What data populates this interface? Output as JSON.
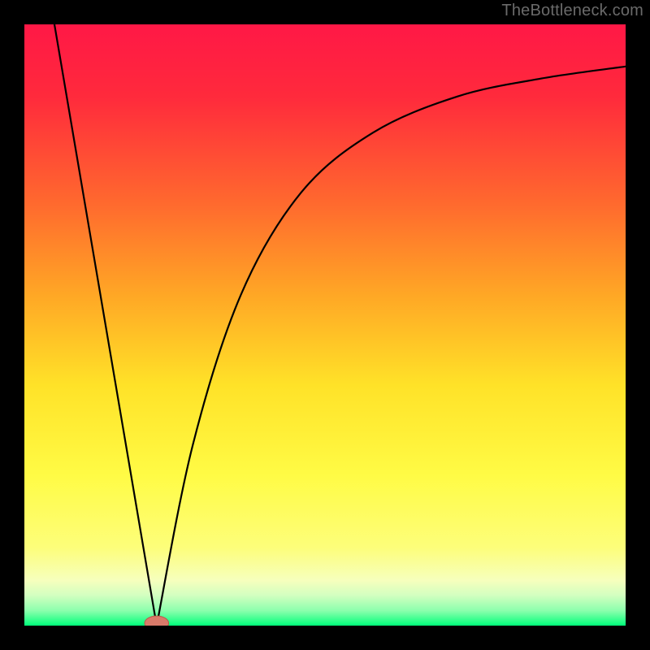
{
  "watermark": "TheBottleneck.com",
  "chart_data": {
    "type": "line",
    "title": "",
    "xlabel": "",
    "ylabel": "",
    "xlim": [
      0,
      100
    ],
    "ylim": [
      0,
      100
    ],
    "gradient_stops": [
      {
        "offset": 0,
        "color": "#ff1846"
      },
      {
        "offset": 0.12,
        "color": "#ff2a3c"
      },
      {
        "offset": 0.3,
        "color": "#ff6a2e"
      },
      {
        "offset": 0.45,
        "color": "#ffa725"
      },
      {
        "offset": 0.6,
        "color": "#ffe228"
      },
      {
        "offset": 0.75,
        "color": "#fffb45"
      },
      {
        "offset": 0.87,
        "color": "#fdfe7a"
      },
      {
        "offset": 0.925,
        "color": "#f6ffbd"
      },
      {
        "offset": 0.95,
        "color": "#d2ffc0"
      },
      {
        "offset": 0.975,
        "color": "#8cffad"
      },
      {
        "offset": 1.0,
        "color": "#00ff7a"
      }
    ],
    "frame_color": "#000000",
    "frame_thickness_px": 30,
    "curve": {
      "color": "#000000",
      "width": 2.2,
      "minimum_x": 22,
      "left_branch": [
        {
          "x": 5,
          "y": 100
        },
        {
          "x": 22,
          "y": 0
        }
      ],
      "right_branch": [
        {
          "x": 22,
          "y": 0
        },
        {
          "x": 28,
          "y": 30
        },
        {
          "x": 36,
          "y": 55
        },
        {
          "x": 46,
          "y": 72
        },
        {
          "x": 58,
          "y": 82
        },
        {
          "x": 72,
          "y": 88
        },
        {
          "x": 86,
          "y": 91
        },
        {
          "x": 100,
          "y": 93
        }
      ]
    },
    "marker": {
      "x": 22,
      "y": 0,
      "rx": 2.0,
      "ry": 1.2,
      "fill": "#d97a6a",
      "stroke": "#b85a4a"
    }
  }
}
